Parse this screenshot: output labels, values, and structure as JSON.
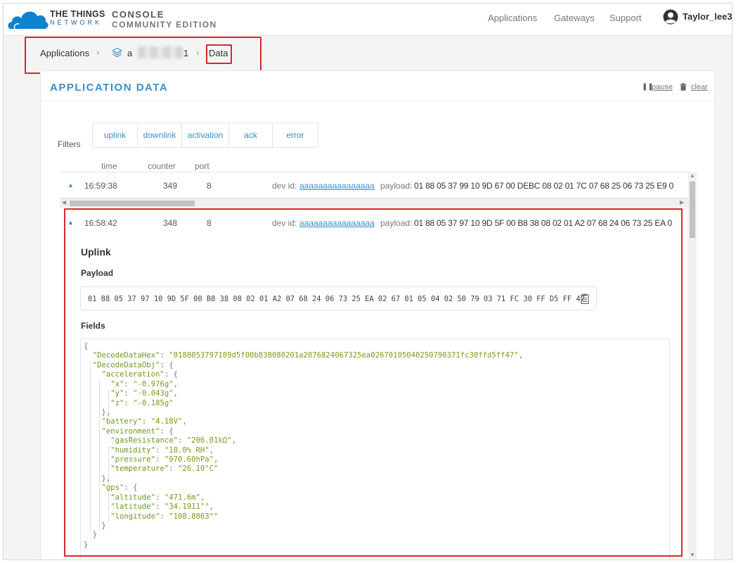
{
  "header": {
    "brand_line1": "THE THINGS",
    "brand_line2": "NETWORK",
    "console_line1": "CONSOLE",
    "console_line2": "COMMUNITY EDITION",
    "nav": [
      "Applications",
      "Gateways",
      "Support"
    ],
    "user": "Taylor_lee3"
  },
  "breadcrumb": {
    "root": "Applications",
    "app_prefix": "a",
    "app_suffix": "1",
    "current": "Data"
  },
  "panel": {
    "title": "APPLICATION DATA",
    "pause": "pause",
    "clear": "clear",
    "filters_label": "Filters",
    "filters": [
      "uplink",
      "downlink",
      "activation",
      "ack",
      "error"
    ]
  },
  "columns": {
    "time": "time",
    "counter": "counter",
    "port": "port"
  },
  "rows": [
    {
      "time": "16:59:38",
      "counter": "349",
      "port": "8",
      "dev_label": "dev id:",
      "dev_id": "aaaaaaaaaaaaaaaa",
      "payload_label": "payload:",
      "payload": "01 88 05 37 99 10 9D 67 00 DEBC 08 02 01 7C 07 68 25 06 73 25 E9 0"
    },
    {
      "time": "16:58:42",
      "counter": "348",
      "port": "8",
      "dev_label": "dev id:",
      "dev_id": "aaaaaaaaaaaaaaaa",
      "payload_label": "payload:",
      "payload": "01 88 05 37 97 10 9D 5F 00 B8 38 08 02 01 A2 07 68 24 06 73 25 EA 0"
    }
  ],
  "detail": {
    "title": "Uplink",
    "payload_label": "Payload",
    "payload": "01 88 05 37 97 10 9D 5F 00 B8 38 08 02 01 A2 07 68 24 06 73 25 EA 02 67 01 05 04 02 50 79 03 71 FC 30 FF D5 FF 47",
    "fields_label": "Fields",
    "decoded_hex_key": "\"DecodeDataHex\"",
    "decoded_hex": "\"0188053797109d5f00b838080201a2076824067325ea02670105040250790371fc30ffd5ff47\"",
    "decoded_obj_key": "\"DecodeDataObj\"",
    "acceleration_key": "\"acceleration\"",
    "x_key": "\"x\"",
    "x": "\"-0.976g\"",
    "y_key": "\"y\"",
    "y": "\"-0.043g\"",
    "z_key": "\"z\"",
    "z": "\"-0.185g\"",
    "battery_key": "\"battery\"",
    "battery": "\"4.18V\"",
    "environment_key": "\"environment\"",
    "gas_key": "\"gasResistance\"",
    "gas": "\"206.01kΩ\"",
    "humidity_key": "\"humidity\"",
    "humidity": "\"18.0% RH\"",
    "pressure_key": "\"pressure\"",
    "pressure": "\"970.60hPa\"",
    "temperature_key": "\"temperature\"",
    "temperature": "\"26.10°C\"",
    "gps_key": "\"gps\"",
    "altitude_key": "\"altitude\"",
    "altitude": "\"471.6m\"",
    "latitude_key": "\"latitude\"",
    "latitude": "\"34.1911°\"",
    "longitude_key": "\"longitude\"",
    "longitude": "\"108.8863°\""
  },
  "colors": {
    "accent": "#3a8fc9",
    "highlight": "#d9282b",
    "json_value": "#7a9a19"
  }
}
